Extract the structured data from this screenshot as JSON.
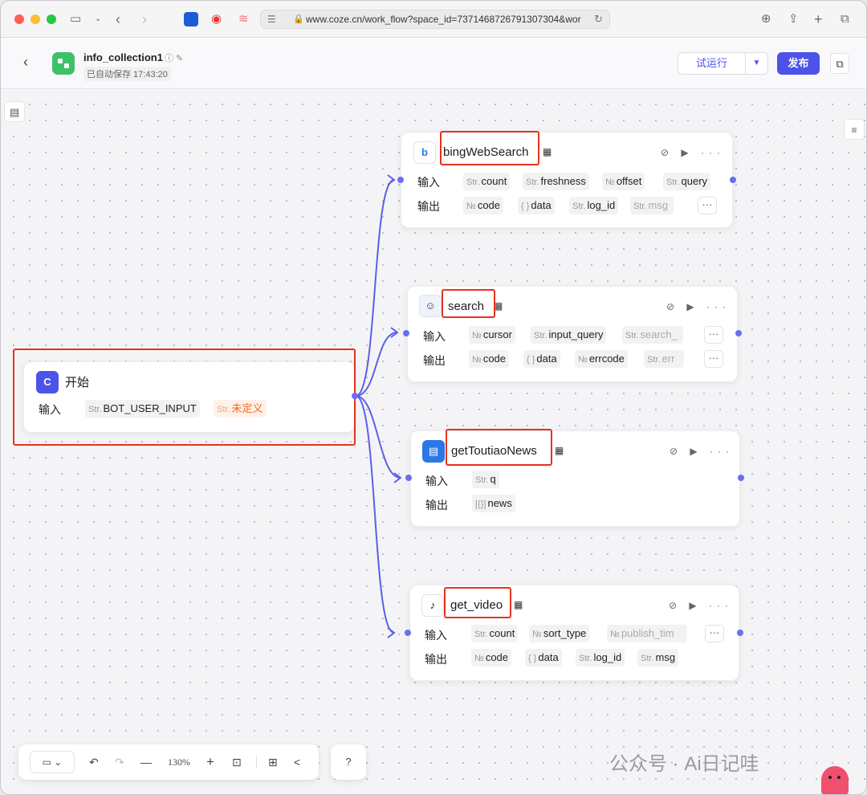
{
  "browser": {
    "url": "www.coze.cn/work_flow?space_id=7371468726791307304&wor",
    "lock_icon": "lock-icon",
    "reload_icon": "reload-icon"
  },
  "header": {
    "app_name": "info_collection1",
    "saved_text": "已自动保存 17:43:20",
    "run_label": "试运行",
    "publish_label": "发布",
    "run_dropdown_icon": "▼",
    "back_icon": "‹",
    "app_icon_color": "#3cc168",
    "accent_color": "#4d53e8"
  },
  "labels": {
    "input": "输入",
    "output": "输出",
    "str": "Str.",
    "num": "№",
    "obj": "{ }",
    "arr": "[{}]",
    "more": "···"
  },
  "nodes": {
    "start": {
      "title": "开始",
      "inputs": [
        {
          "type": "Str.",
          "name": "BOT_USER_INPUT"
        },
        {
          "type": "Str.",
          "name": "未定义"
        }
      ]
    },
    "bing": {
      "title": "bingWebSearch",
      "inputs": [
        {
          "type": "Str.",
          "name": "count"
        },
        {
          "type": "Str.",
          "name": "freshness"
        },
        {
          "type": "№",
          "name": "offset"
        },
        {
          "type": "Str.",
          "name": "query"
        }
      ],
      "outputs": [
        {
          "type": "№",
          "name": "code"
        },
        {
          "type": "{ }",
          "name": "data"
        },
        {
          "type": "Str.",
          "name": "log_id"
        },
        {
          "type": "Str.",
          "name": "msg"
        }
      ]
    },
    "search": {
      "title": "search",
      "inputs": [
        {
          "type": "№",
          "name": "cursor"
        },
        {
          "type": "Str.",
          "name": "input_query"
        },
        {
          "type": "Str.",
          "name": "search_"
        }
      ],
      "outputs": [
        {
          "type": "№",
          "name": "code"
        },
        {
          "type": "{ }",
          "name": "data"
        },
        {
          "type": "№",
          "name": "errcode"
        },
        {
          "type": "Str.",
          "name": "err"
        }
      ]
    },
    "toutiao": {
      "title": "getToutiaoNews",
      "inputs": [
        {
          "type": "Str.",
          "name": "q"
        }
      ],
      "outputs": [
        {
          "type": "[{}]",
          "name": "news"
        }
      ]
    },
    "video": {
      "title": "get_video",
      "inputs": [
        {
          "type": "Str.",
          "name": "count"
        },
        {
          "type": "№",
          "name": "sort_type"
        },
        {
          "type": "№",
          "name": "publish_tim"
        }
      ],
      "outputs": [
        {
          "type": "№",
          "name": "code"
        },
        {
          "type": "{ }",
          "name": "data"
        },
        {
          "type": "Str.",
          "name": "log_id"
        },
        {
          "type": "Str.",
          "name": "msg"
        }
      ]
    }
  },
  "toolbar": {
    "zoom": "130%"
  },
  "watermark": "公众号 · Ai日记哇"
}
